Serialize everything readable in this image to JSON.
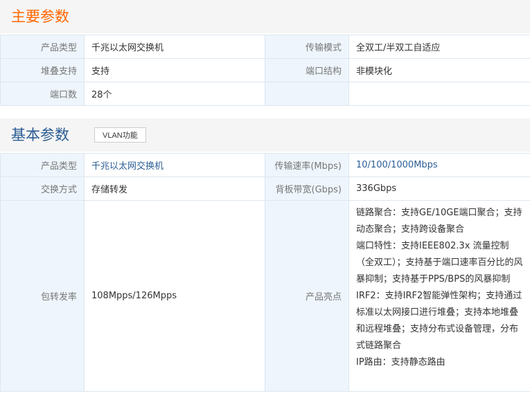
{
  "main_params": {
    "title": "主要参数",
    "rows": [
      {
        "l1": "产品类型",
        "v1": "千兆以太网交换机",
        "l2": "传输模式",
        "v2": "全双工/半双工自适应"
      },
      {
        "l1": "堆叠支持",
        "v1": "支持",
        "l2": "端口结构",
        "v2": "非模块化"
      },
      {
        "l1": "端口数",
        "v1": "28个",
        "l2": "",
        "v2": ""
      }
    ]
  },
  "basic_params": {
    "title": "基本参数",
    "tag_button": "VLAN功能",
    "rows": [
      {
        "l1": "产品类型",
        "v1": "千兆以太网交换机",
        "l2": "传输速率(Mbps)",
        "v2": "10/100/1000Mbps"
      },
      {
        "l1": "交换方式",
        "v1": "存储转发",
        "l2": "背板带宽(Gbps)",
        "v2": "336Gbps"
      }
    ],
    "big_row": {
      "l1": "包转发率",
      "v1": "108Mpps/126Mpps",
      "l2": "产品亮点",
      "lines": [
        "链路聚合：支持GE/10GE端口聚合；支持动态聚合；支持跨设备聚合",
        "端口特性：支持IEEE802.3x 流量控制（全双工）；支持基于端口速率百分比的风暴抑制；支持基于PPS/BPS的风暴抑制",
        "IRF2：支持IRF2智能弹性架构；支持通过标准以太网接口进行堆叠；支持本地堆叠和远程堆叠；支持分布式设备管理，分布式链路聚合",
        "IP路由：支持静态路由"
      ]
    }
  }
}
